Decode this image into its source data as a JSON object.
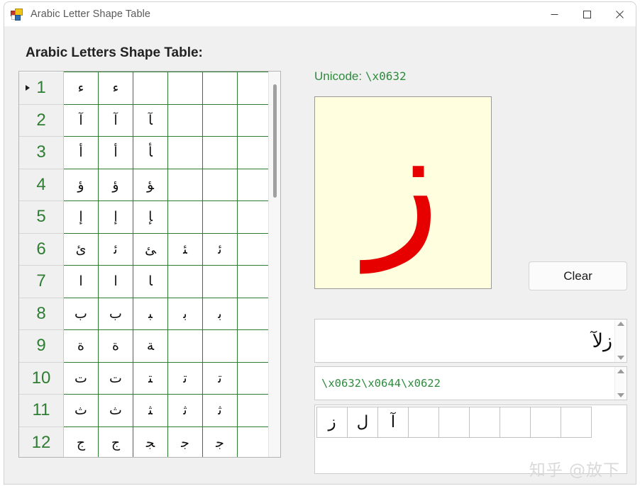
{
  "window": {
    "title": "Arabic Letter Shape Table",
    "icon": "winforms-app-icon",
    "controls": {
      "minimize": "Minimize",
      "maximize": "Maximize",
      "close": "Close"
    }
  },
  "left_panel": {
    "heading": "Arabic Letters Shape Table:",
    "grid": {
      "columns": 6,
      "rows": [
        {
          "index": "1",
          "cells": [
            "ء",
            "ء",
            "",
            "",
            "",
            ""
          ]
        },
        {
          "index": "2",
          "cells": [
            "آ",
            "آ",
            "ﺂ",
            "",
            "",
            ""
          ]
        },
        {
          "index": "3",
          "cells": [
            "أ",
            "أ",
            "ﺄ",
            "",
            "",
            ""
          ]
        },
        {
          "index": "4",
          "cells": [
            "ؤ",
            "ؤ",
            "ﺆ",
            "",
            "",
            ""
          ]
        },
        {
          "index": "5",
          "cells": [
            "إ",
            "إ",
            "ﺈ",
            "",
            "",
            ""
          ]
        },
        {
          "index": "6",
          "cells": [
            "ئ",
            "ﺋ",
            "ﺊ",
            "ﺌ",
            "ﺋ",
            ""
          ]
        },
        {
          "index": "7",
          "cells": [
            "ا",
            "ا",
            "ﺎ",
            "",
            "",
            ""
          ]
        },
        {
          "index": "8",
          "cells": [
            "ب",
            "ب",
            "ﺒ",
            "ﺑ",
            "ﺑ",
            ""
          ]
        },
        {
          "index": "9",
          "cells": [
            "ة",
            "ة",
            "ﺔ",
            "",
            "",
            ""
          ]
        },
        {
          "index": "10",
          "cells": [
            "ت",
            "ت",
            "ﺘ",
            "ﺗ",
            "ﺗ",
            ""
          ]
        },
        {
          "index": "11",
          "cells": [
            "ث",
            "ث",
            "ﺜ",
            "ﺛ",
            "ﺛ",
            ""
          ]
        },
        {
          "index": "12",
          "cells": [
            "ج",
            "ج",
            "ﺠ",
            "ﺟ",
            "ﺟ",
            ""
          ]
        }
      ],
      "selected_row": "1"
    }
  },
  "right_panel": {
    "unicode_label": "Unicode:",
    "unicode_value": "\\x0632",
    "preview_glyph": "ز",
    "clear_button": "Clear",
    "arabic_textbox": "زلآ",
    "codes_textbox": "\\x0632\\x0644\\x0622",
    "char_cells": [
      "ز",
      "ل",
      "آ",
      "",
      "",
      "",
      "",
      "",
      ""
    ]
  },
  "watermark": "知乎 @放下",
  "colors": {
    "form_background": "#f0f0f0",
    "grid_line": "#2e7d32",
    "row_header_text": "#2e7d32",
    "unicode_text": "#2e8b3f",
    "preview_background": "#ffffe0",
    "preview_glyph": "#e60000",
    "code_text": "#2e8b3f"
  }
}
